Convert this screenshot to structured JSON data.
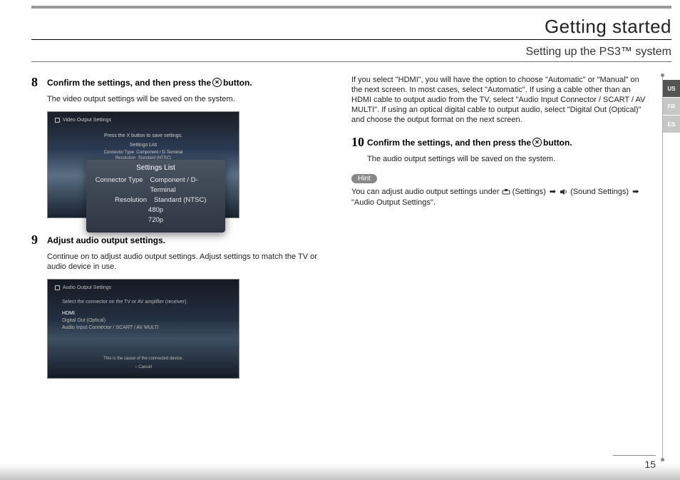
{
  "chapter": "Getting started",
  "section": "Setting up the PS3™ system",
  "left": {
    "step8": {
      "num": "8",
      "title_a": "Confirm the settings, and then press the",
      "title_b": "button.",
      "body": "The video output settings will be saved on the system.",
      "shot": {
        "header": "Video Output Settings",
        "line1": "Press the X button to save settings.",
        "line2": "Settings List",
        "line3_l": "Connector Type",
        "line3_r": "Component / D-Terminal",
        "line4_l": "Resolution",
        "line4_r": "Standard (NTSC)",
        "popup_title": "Settings List",
        "popup_r1_l": "Connector Type",
        "popup_r1_r": "Component / D-Terminal",
        "popup_r2_l": "Resolution",
        "popup_r2_r": "Standard (NTSC)",
        "popup_r3": "480p",
        "popup_r4": "720p"
      }
    },
    "step9": {
      "num": "9",
      "title": "Adjust audio output settings.",
      "body": "Continue on to adjust audio output settings. Adjust settings to match the TV or audio device in use.",
      "shot": {
        "header": "Audio Output Settings",
        "line1": "Select the connector on the TV or AV amplifier (receiver).",
        "opt1": "HDMI",
        "opt2": "Digital Out (Optical)",
        "opt3": "Audio Input Connector / SCART / AV MULTI",
        "foot1": "This is the cause of the connected device.",
        "foot2": "Cancel"
      }
    }
  },
  "right": {
    "intro": "If you select \"HDMI\", you will have the option to choose \"Automatic\" or \"Manual\" on the next screen. In most cases, select \"Automatic\". If using a cable other than an HDMI cable to output audio from the TV, select \"Audio Input Connector / SCART / AV MULTI\". If using an optical digital cable to output audio, select \"Digital Out (Optical)\" and choose the output format on the next screen.",
    "step10": {
      "num": "10",
      "title_a": "Confirm the settings, and then press the",
      "title_b": "button.",
      "body": "The audio output settings will be saved on the system."
    },
    "hint_label": "Hint",
    "hint_a": "You can adjust audio output settings under ",
    "hint_settings": " (Settings) ",
    "hint_sound": " (Sound Settings) ",
    "hint_b": " \"Audio Output Settings\"."
  },
  "langs": {
    "us": "US",
    "fr": "FR",
    "es": "ES"
  },
  "pagenum": "15"
}
